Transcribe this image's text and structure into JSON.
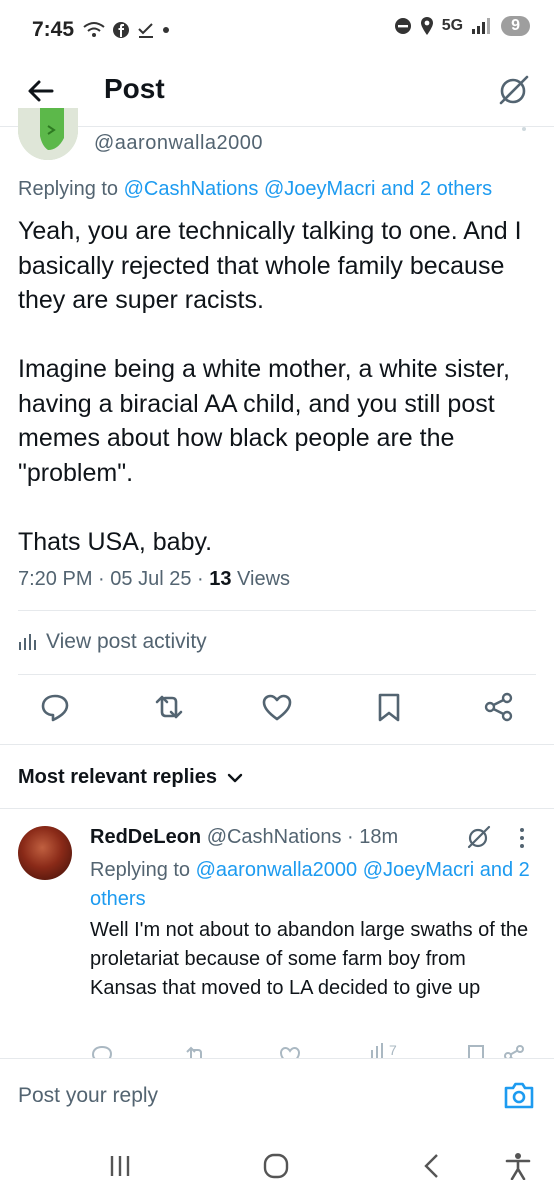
{
  "status_bar": {
    "time": "7:45",
    "network": "5G",
    "notification_count": "9"
  },
  "header": {
    "title": "Post"
  },
  "post": {
    "handle": "@aaronwalla2000",
    "replying_prefix": "Replying to ",
    "replying_mentions": "@CashNations @JoeyMacri and 2 others",
    "text": "Yeah, you are technically talking to one. And I basically rejected that whole family because they are super racists.\n\nImagine being a white mother, a white sister, having a biracial AA child, and you still post memes about how black people are the \"problem\".\n\nThats USA, baby.",
    "time": "7:20 PM",
    "date": "05 Jul 25",
    "views_count": "13",
    "views_label": "Views",
    "activity_label": "View post activity"
  },
  "replies": {
    "sort_label": "Most relevant replies",
    "items": [
      {
        "name": "RedDeLeon",
        "handle": "@CashNations",
        "age": "18m",
        "replying_prefix": "Replying to ",
        "replying_mentions": "@aaronwalla2000 @JoeyMacri and 2 others",
        "text": "Well I'm not about to abandon large swaths of the proletariat because of some farm boy from Kansas that moved to LA decided to give up",
        "views": "7"
      }
    ]
  },
  "compose": {
    "placeholder": "Post your reply"
  },
  "colors": {
    "accent": "#1d9bf0",
    "secondary_text": "#536471",
    "primary_text": "#0f1419"
  },
  "icons": [
    "back-arrow-icon",
    "grok-icon",
    "reply-icon",
    "repost-icon",
    "like-icon",
    "bookmark-icon",
    "share-icon",
    "camera-icon"
  ]
}
